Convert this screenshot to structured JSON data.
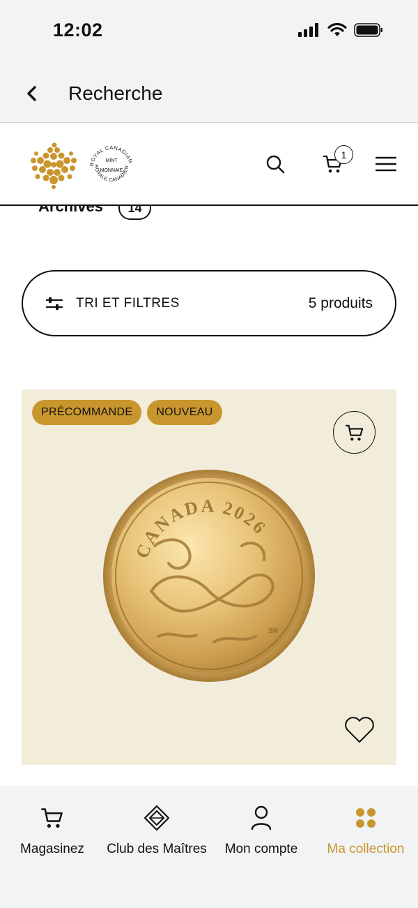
{
  "status": {
    "time": "12:02"
  },
  "nav": {
    "title": "Recherche"
  },
  "header": {
    "cart_count": "1"
  },
  "archives": {
    "label": "Archives",
    "count": "14"
  },
  "filter": {
    "label": "TRI ET FILTRES",
    "count": "5 produits"
  },
  "product": {
    "badges": [
      "PRÉCOMMANDE",
      "NOUVEAU"
    ],
    "coin_text": {
      "country": "CANADA",
      "year": "2026",
      "mark": "SN"
    }
  },
  "tabs": [
    {
      "label": "Magasinez",
      "icon": "cart-icon"
    },
    {
      "label": "Club des Maîtres",
      "icon": "diamond-icon"
    },
    {
      "label": "Mon compte",
      "icon": "person-icon"
    },
    {
      "label": "Ma collection",
      "icon": "grid-dots-icon",
      "active": true
    }
  ],
  "colors": {
    "accent": "#c9962d",
    "card_bg": "#f2ecdb",
    "chrome_bg": "#f2f3f5"
  }
}
